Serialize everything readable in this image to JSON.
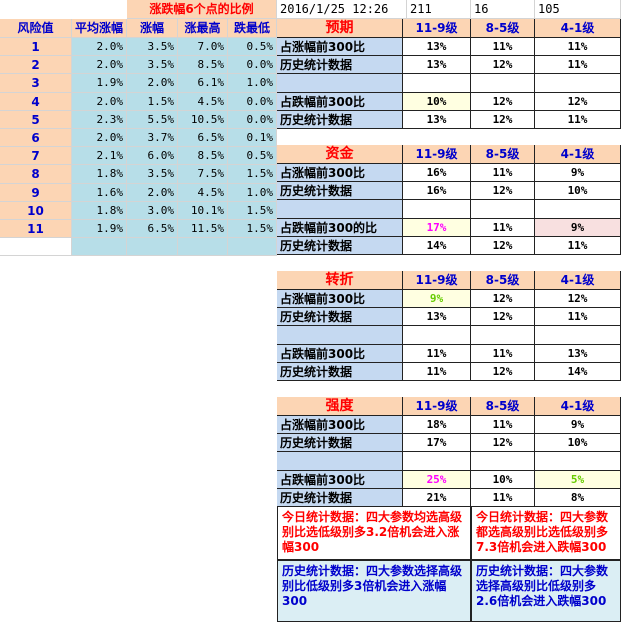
{
  "header": {
    "title": "涨跌幅6个点的比例",
    "datetime": "2016/1/25 12:26",
    "n1": "211",
    "n2": "16",
    "n3": "105"
  },
  "risk_table": {
    "headers": [
      "风险值",
      "平均涨幅",
      "涨幅",
      "涨最高",
      "跌最低"
    ],
    "rows": [
      [
        "1",
        "2.0%",
        "3.5%",
        "7.0%",
        "0.5%"
      ],
      [
        "2",
        "2.0%",
        "3.5%",
        "8.5%",
        "0.0%"
      ],
      [
        "3",
        "1.9%",
        "2.0%",
        "6.1%",
        "1.0%"
      ],
      [
        "4",
        "2.0%",
        "1.5%",
        "4.5%",
        "0.0%"
      ],
      [
        "5",
        "2.3%",
        "5.5%",
        "10.5%",
        "0.0%"
      ],
      [
        "6",
        "2.0%",
        "3.7%",
        "6.5%",
        "0.1%"
      ],
      [
        "7",
        "2.1%",
        "6.0%",
        "8.5%",
        "0.5%"
      ],
      [
        "8",
        "1.8%",
        "3.5%",
        "7.5%",
        "1.5%"
      ],
      [
        "9",
        "1.6%",
        "2.0%",
        "4.5%",
        "1.0%"
      ],
      [
        "10",
        "1.8%",
        "3.0%",
        "10.1%",
        "1.5%"
      ],
      [
        "11",
        "1.9%",
        "6.5%",
        "11.5%",
        "1.5%"
      ]
    ]
  },
  "blocks": [
    {
      "title": "预期",
      "cols": [
        "11-9级",
        "8-5级",
        "4-1级"
      ],
      "rows": [
        {
          "label": "占涨幅前300比",
          "v": [
            "13%",
            "11%",
            "11%"
          ]
        },
        {
          "label": "历史统计数据",
          "v": [
            "13%",
            "12%",
            "11%"
          ]
        },
        {
          "label": "",
          "v": [
            "",
            "",
            ""
          ]
        },
        {
          "label": "占跌幅前300比",
          "v": [
            "10%",
            "12%",
            "12%"
          ]
        },
        {
          "label": "历史统计数据",
          "v": [
            "13%",
            "12%",
            "11%"
          ]
        }
      ]
    },
    {
      "title": "资金",
      "cols": [
        "11-9级",
        "8-5级",
        "4-1级"
      ],
      "rows": [
        {
          "label": "占涨幅前300比",
          "v": [
            "16%",
            "11%",
            "9%"
          ]
        },
        {
          "label": "历史统计数据",
          "v": [
            "16%",
            "12%",
            "10%"
          ]
        },
        {
          "label": "",
          "v": [
            "",
            "",
            ""
          ]
        },
        {
          "label": "占跌幅前300的比",
          "v": [
            "17%",
            "11%",
            "9%"
          ]
        },
        {
          "label": "历史统计数据",
          "v": [
            "14%",
            "12%",
            "11%"
          ]
        }
      ]
    },
    {
      "title": "转折",
      "cols": [
        "11-9级",
        "8-5级",
        "4-1级"
      ],
      "rows": [
        {
          "label": "占涨幅前300比",
          "v": [
            "9%",
            "12%",
            "12%"
          ]
        },
        {
          "label": "历史统计数据",
          "v": [
            "13%",
            "12%",
            "11%"
          ]
        },
        {
          "label": "",
          "v": [
            "",
            "",
            ""
          ]
        },
        {
          "label": "占跌幅前300比",
          "v": [
            "11%",
            "11%",
            "13%"
          ]
        },
        {
          "label": "历史统计数据",
          "v": [
            "11%",
            "12%",
            "14%"
          ]
        }
      ]
    },
    {
      "title": "强度",
      "cols": [
        "11-9级",
        "8-5级",
        "4-1级"
      ],
      "rows": [
        {
          "label": "占涨幅前300比",
          "v": [
            "18%",
            "11%",
            "9%"
          ]
        },
        {
          "label": "历史统计数据",
          "v": [
            "17%",
            "12%",
            "10%"
          ]
        },
        {
          "label": "",
          "v": [
            "",
            "",
            ""
          ]
        },
        {
          "label": "占跌幅前300比",
          "v": [
            "25%",
            "10%",
            "5%"
          ]
        },
        {
          "label": "历史统计数据",
          "v": [
            "21%",
            "11%",
            "8%"
          ]
        }
      ]
    }
  ],
  "notes": {
    "today_left": "今日统计数据：四大参数均选高级别比选低级别多3.2倍机会进入涨幅300",
    "today_right": "今日统计数据：四大参数都选高级别比选低级别多7.3倍机会进入跌幅300",
    "hist_left": "历史统计数据：四大参数选择高级别比低级别多3倍机会进入涨幅300",
    "hist_right": "历史统计数据：四大参数选择高级别比低级别多2.6倍机会进入跌幅300"
  },
  "colors": {
    "peach": "#fcd5b4",
    "light_blue": "#b7dee8",
    "lavender": "#c5d9f1",
    "title_red": "#ff0000",
    "index_blue": "#0000cc"
  }
}
